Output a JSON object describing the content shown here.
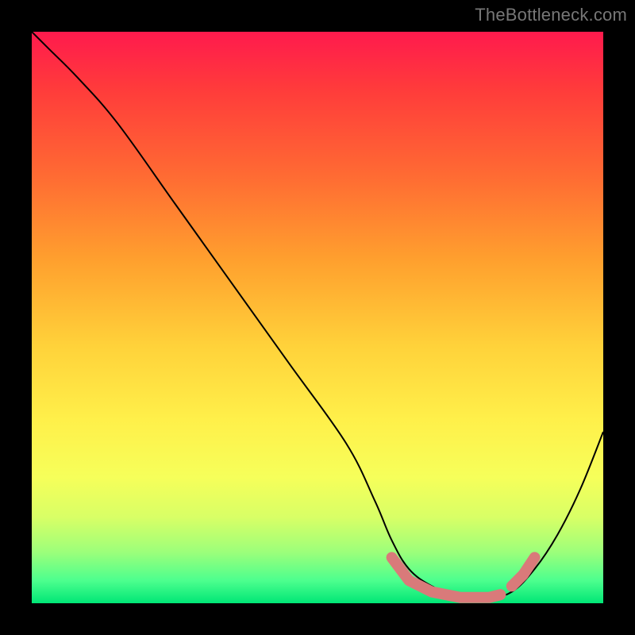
{
  "watermark": "TheBottleneck.com",
  "chart_data": {
    "type": "line",
    "title": "",
    "xlabel": "",
    "ylabel": "",
    "xlim": [
      0,
      100
    ],
    "ylim": [
      0,
      100
    ],
    "background": "rainbow-vertical-red-to-green",
    "series": [
      {
        "name": "curve",
        "color": "#000000",
        "stroke_width": 2,
        "x": [
          0,
          3,
          8,
          15,
          25,
          35,
          45,
          55,
          60,
          63,
          66,
          70,
          75,
          80,
          84,
          88,
          92,
          96,
          100
        ],
        "y": [
          100,
          97,
          92,
          84,
          70,
          56,
          42,
          28,
          18,
          11,
          6,
          3,
          1,
          1,
          2,
          6,
          12,
          20,
          30
        ]
      },
      {
        "name": "highlight-flat",
        "color": "#d97a7a",
        "stroke_width": 14,
        "linecap": "round",
        "x": [
          63,
          66,
          70,
          75,
          80,
          82
        ],
        "y": [
          8,
          4,
          2,
          1,
          1,
          1.5
        ]
      },
      {
        "name": "highlight-rise",
        "color": "#d97a7a",
        "stroke_width": 14,
        "linecap": "round",
        "x": [
          84,
          86,
          88
        ],
        "y": [
          3,
          5,
          8
        ]
      }
    ]
  }
}
